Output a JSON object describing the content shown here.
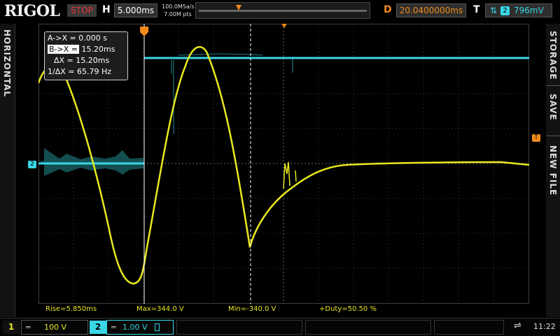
{
  "header": {
    "logo": "RIGOL",
    "run_status": "STOP",
    "h_label": "H",
    "timebase": "5.000ms",
    "sample_rate": "100.0MSa/s",
    "memory_depth": "7.00M pts",
    "d_label": "D",
    "delay": "20.0400000ms",
    "t_label": "T",
    "trigger_arrows": "⇅",
    "trigger_source": "2",
    "trigger_level": "796mV"
  },
  "side": {
    "left_tab": "HORIZONTAL",
    "right_tab_1": "STORAGE",
    "right_tab_2": "SAVE",
    "right_tab_3": "NEW FILE"
  },
  "markers": {
    "ch2": "2",
    "trig": "T"
  },
  "cursor_panel": {
    "a_label": "A->X =",
    "a_value": "0.000 s",
    "b_label": "B->X =",
    "b_value": "15.20ms",
    "dx_label": "ΔX =",
    "dx_value": "15.20ms",
    "inv_label": "1/ΔX =",
    "inv_value": "65.79 Hz"
  },
  "measurements": {
    "rise": "Rise=5.850ms",
    "max": "Max=344.0 V",
    "min": "Min=-340.0 V",
    "duty": "+Duty=50.50 %"
  },
  "channels": [
    {
      "number": "1",
      "coupling": "═",
      "scale": "100 V",
      "color": "#e8e820"
    },
    {
      "number": "2",
      "coupling": "═",
      "scale": "1.00 V",
      "color": "#39d6e6"
    }
  ],
  "status": {
    "usb_icon": "usb-icon",
    "time": "11:22"
  },
  "colors": {
    "ch1": "#e8e820",
    "ch2": "#39d6e6",
    "accent": "#f08a1c",
    "stop": "#e33"
  }
}
